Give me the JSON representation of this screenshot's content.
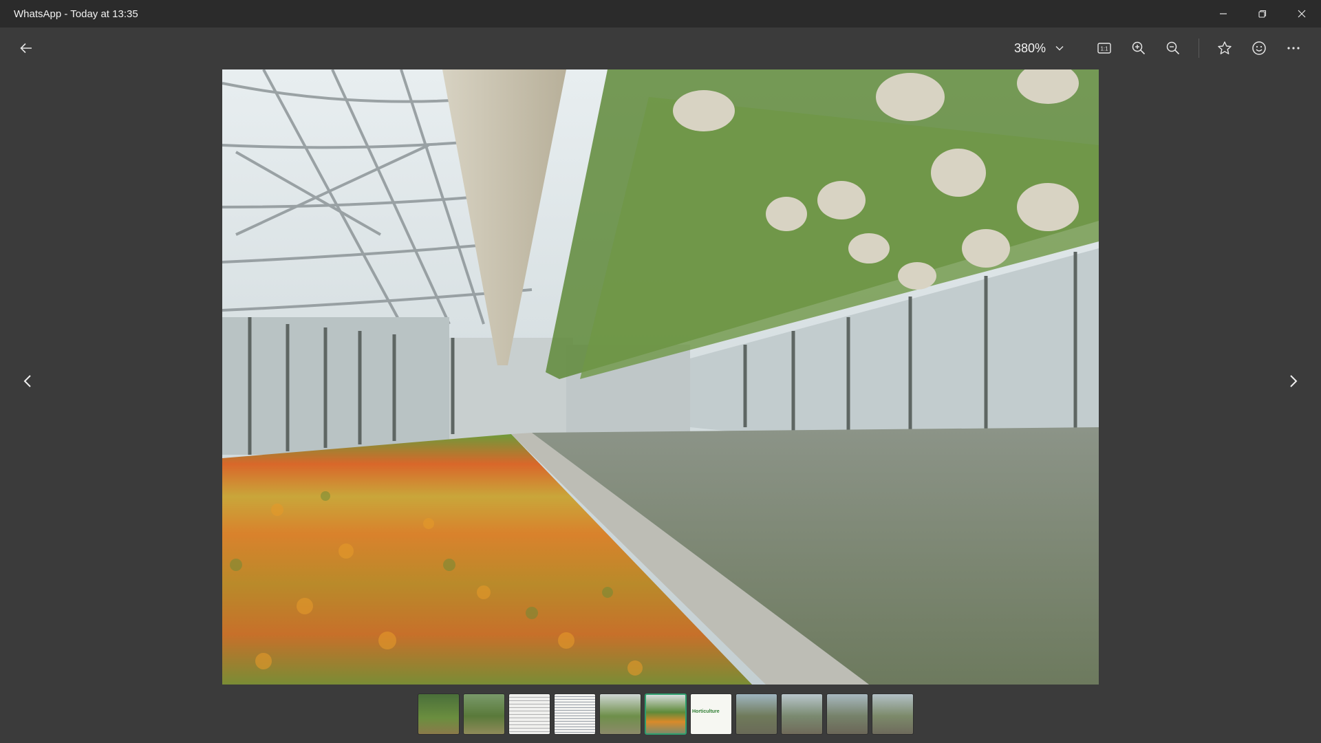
{
  "window": {
    "title": "WhatsApp - Today at 13:35",
    "controls": [
      "minimize-icon",
      "restore-icon",
      "close-icon"
    ]
  },
  "toolbar": {
    "back_icon": "arrow-left-icon",
    "zoom_value": "380%",
    "buttons": [
      "actual-size-icon",
      "zoom-in-icon",
      "zoom-out-icon",
      "star-icon",
      "smiley-icon",
      "more-icon"
    ]
  },
  "viewer": {
    "image_subject": "greenhouse photo",
    "prev_icon": "chevron-left-icon",
    "next_icon": "chevron-right-icon"
  },
  "filmstrip": {
    "count": 11,
    "selected_index": 5,
    "thumbnails": [
      {
        "kind": "field-photo"
      },
      {
        "kind": "field-photo"
      },
      {
        "kind": "document"
      },
      {
        "kind": "document"
      },
      {
        "kind": "greenhouse"
      },
      {
        "kind": "greenhouse-flowers"
      },
      {
        "kind": "title-card",
        "text": "Horticulture"
      },
      {
        "kind": "group-photo"
      },
      {
        "kind": "group-photo"
      },
      {
        "kind": "group-photo"
      },
      {
        "kind": "group-photo"
      }
    ]
  },
  "colors": {
    "titlebar": "#2b2b2b",
    "background": "#3b3b3b",
    "selected_thumb_border": "#2e9e6e"
  }
}
